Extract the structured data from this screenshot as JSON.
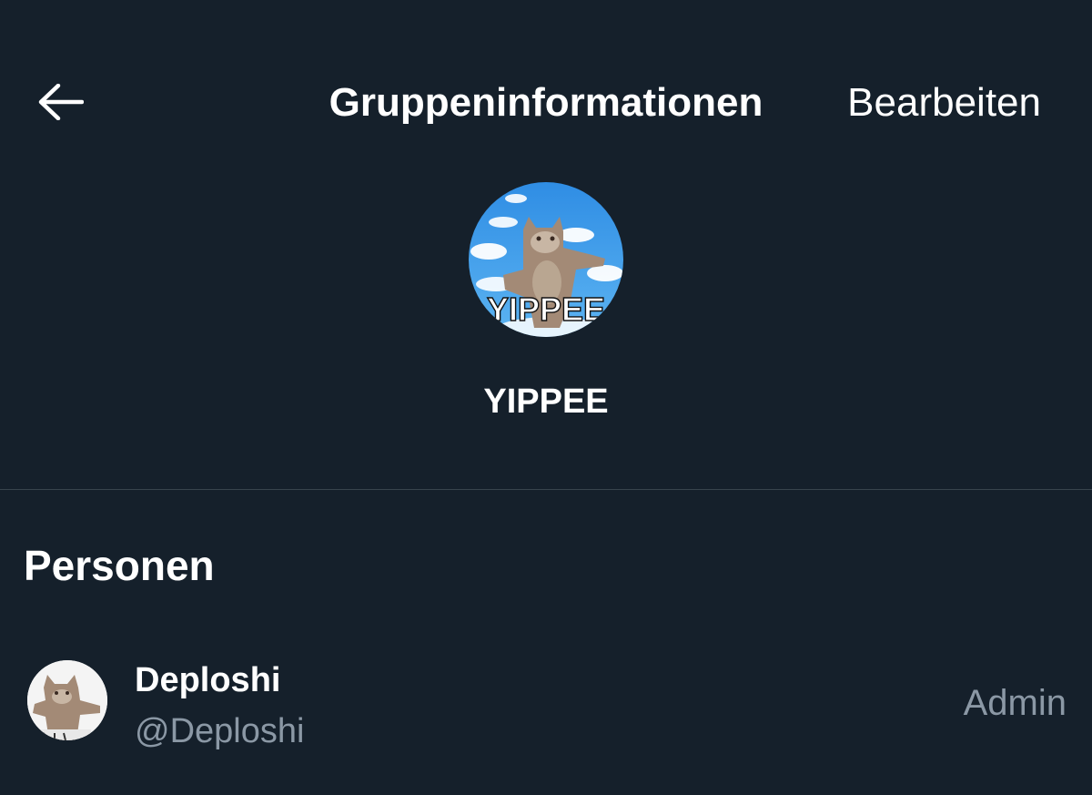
{
  "header": {
    "back_icon": "arrow-left-icon",
    "title": "Gruppeninformationen",
    "edit_label": "Bearbeiten"
  },
  "group": {
    "avatar_icon": "cat-photo-avatar",
    "avatar_caption": "YIPPEE",
    "name": "YIPPEE"
  },
  "people": {
    "section_title": "Personen",
    "members": [
      {
        "name": "Deploshi",
        "handle": "@Deploshi",
        "role": "Admin",
        "avatar_icon": "cat-photo-avatar"
      }
    ]
  },
  "colors": {
    "background": "#15202b",
    "divider": "#38444d",
    "secondary_text": "#8b98a5",
    "primary_text": "#ffffff"
  }
}
